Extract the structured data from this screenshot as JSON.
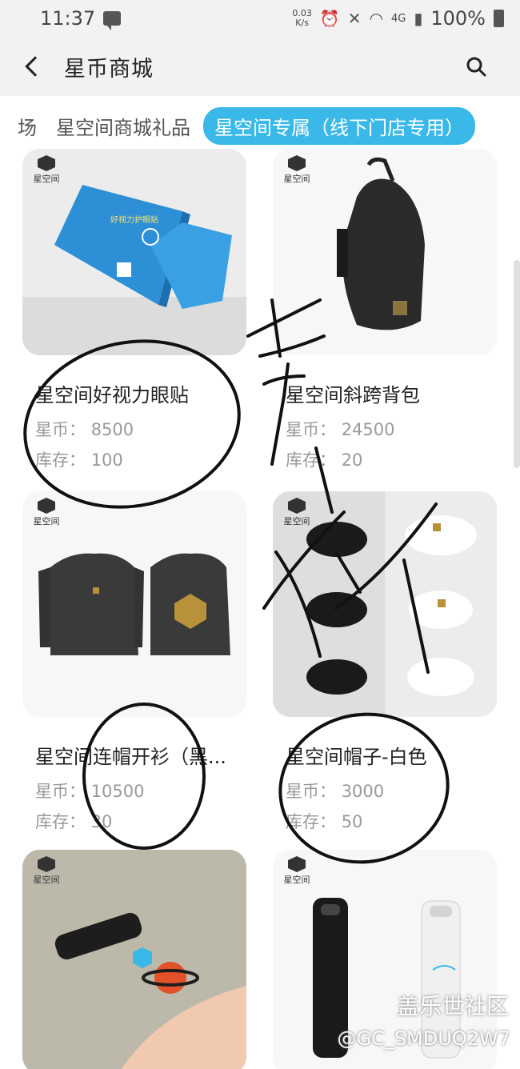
{
  "status_bar": {
    "time": "11:37",
    "net_speed_value": "0.03",
    "net_speed_unit": "K/s",
    "network": "4G",
    "battery": "100%"
  },
  "header": {
    "title": "星币商城"
  },
  "tabs": [
    "场",
    "星空间商城礼品",
    "星空间专属（线下门店专用）"
  ],
  "active_tab_index": 2,
  "brand_logo_text": "星空间",
  "price_label": "星币：",
  "stock_label": "库存：",
  "products": [
    {
      "name": "星空间好视力眼贴",
      "price": "8500",
      "stock": "100"
    },
    {
      "name": "星空间斜跨背包",
      "price": "24500",
      "stock": "20"
    },
    {
      "name": "星空间连帽开衫（黑...",
      "price": "10500",
      "stock": "30"
    },
    {
      "name": "星空间帽子-白色",
      "price": "3000",
      "stock": "50"
    },
    {
      "name": "",
      "price": "",
      "stock": ""
    },
    {
      "name": "",
      "price": "",
      "stock": ""
    }
  ],
  "eye_patch_box_text": "好视力护眼贴",
  "watermark": {
    "line1": "盖乐世社区",
    "line2": "@GC_SMDUQ2W7"
  },
  "colors": {
    "accent": "#3ab8e8",
    "background": "#ffffff",
    "header_bg": "#f2f2f2"
  }
}
